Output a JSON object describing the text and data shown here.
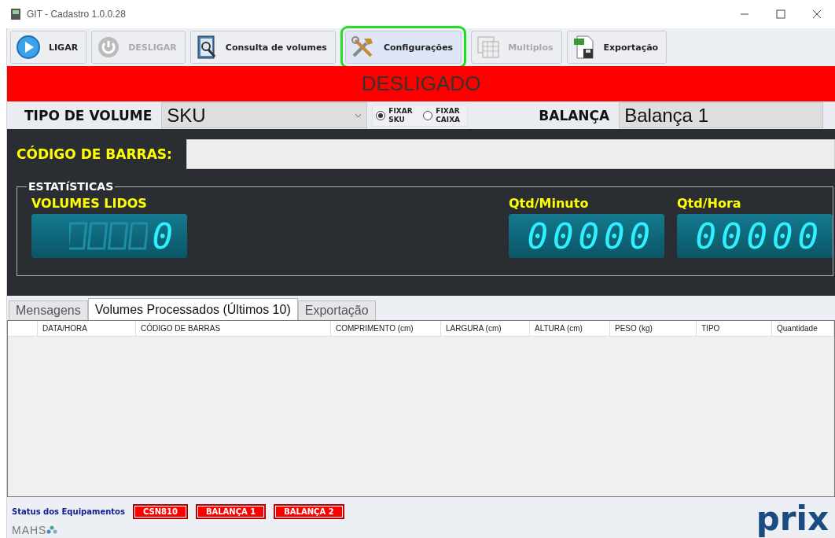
{
  "window": {
    "title": "GIT - Cadastro 1.0.0.28"
  },
  "toolbar": [
    {
      "kind": "play",
      "label": "LIGAR",
      "disabled": false,
      "selected": false
    },
    {
      "kind": "power",
      "label": "DESLIGAR",
      "disabled": true,
      "selected": false
    },
    {
      "kind": "search",
      "label": "Consulta de volumes",
      "disabled": false,
      "selected": false
    },
    {
      "kind": "tools",
      "label": "Configurações",
      "disabled": false,
      "selected": true
    },
    {
      "kind": "grid",
      "label": "Multiplos",
      "disabled": true,
      "selected": false
    },
    {
      "kind": "xls",
      "label": "Exportação",
      "disabled": false,
      "selected": false
    }
  ],
  "status_banner": "DESLIGADO",
  "options": {
    "type_label": "TIPO DE VOLUME",
    "type_value": "SKU",
    "radios": [
      {
        "label": "FIXAR SKU",
        "checked": true
      },
      {
        "label": "FIXAR CAIXA",
        "checked": false
      }
    ],
    "scale_label": "BALANÇA",
    "scale_value": "Balança 1"
  },
  "barcode": {
    "label": "CÓDIGO DE BARRAS:"
  },
  "statistics": {
    "title": "ESTATíSTICAS",
    "counters": [
      {
        "label": "VOLUMES LIDOS",
        "value": "0"
      },
      {
        "label": "Qtd/Minuto",
        "value": "00000"
      },
      {
        "label": "Qtd/Hora",
        "value": "00000"
      }
    ]
  },
  "tabs": [
    {
      "label": "Mensagens",
      "selected": false
    },
    {
      "label": "Volumes Processados (Últimos 10)",
      "selected": true
    },
    {
      "label": "Exportação",
      "selected": false
    }
  ],
  "table": {
    "columns": [
      "DATA/HORA",
      "CÓDIGO DE BARRAS",
      "COMPRIMENTO (cm)",
      "LARGURA (cm)",
      "ALTURA (cm)",
      "PESO (kg)",
      "TIPO",
      "Quantidade"
    ]
  },
  "status_bar": {
    "label": "Status dos Equipamentos",
    "devices": [
      "CSN810",
      "BALANÇA 1",
      "BALANÇA 2"
    ],
    "logo_left": "MAHS",
    "logo_right": "prix"
  }
}
